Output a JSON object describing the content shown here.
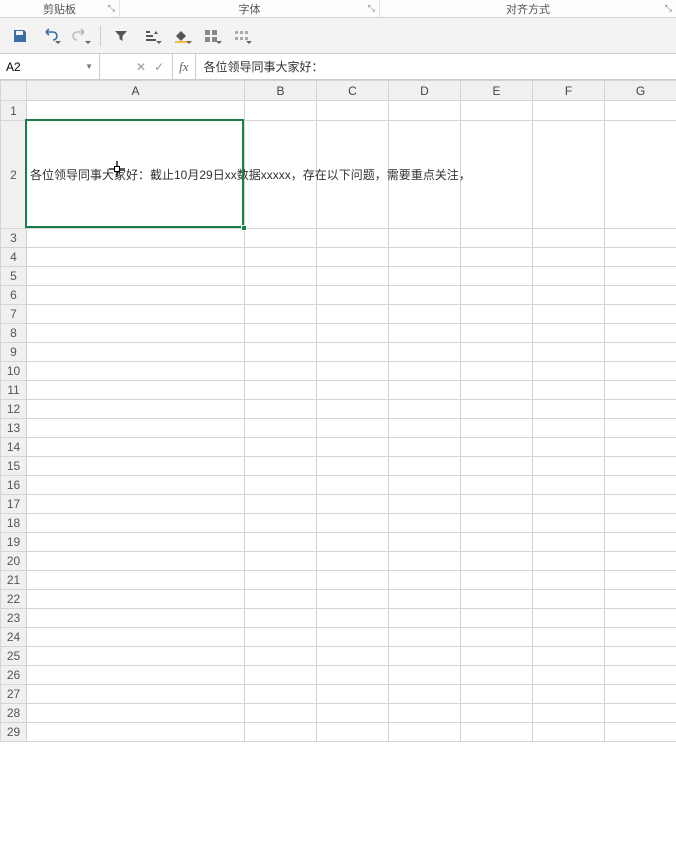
{
  "ribbon": {
    "groups": [
      "剪贴板",
      "字体",
      "对齐方式"
    ]
  },
  "nameBox": {
    "value": "A2"
  },
  "formulaBar": {
    "fxLabel": "fx",
    "value": "各位领导同事大家好："
  },
  "columns": [
    "A",
    "B",
    "C",
    "D",
    "E",
    "F",
    "G"
  ],
  "rows": [
    1,
    2,
    3,
    4,
    5,
    6,
    7,
    8,
    9,
    10,
    11,
    12,
    13,
    14,
    15,
    16,
    17,
    18,
    19,
    20,
    21,
    22,
    23,
    24,
    25,
    26,
    27,
    28,
    29
  ],
  "cells": {
    "A2_overflow": "各位领导同事大家好：截止10月29日xx数据xxxxx，存在以下问题，需要重点关注，"
  },
  "selection": {
    "cell": "A2"
  }
}
